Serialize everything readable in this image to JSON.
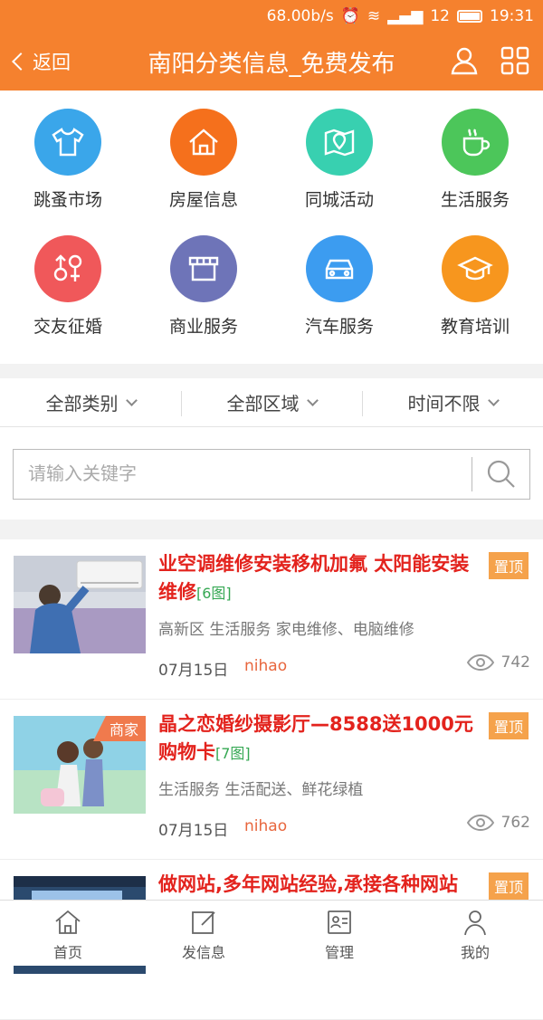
{
  "status": {
    "speed": "68.00b/s",
    "signal_num": "12",
    "time": "19:31"
  },
  "header": {
    "back_label": "返回",
    "title": "南阳分类信息_免费发布"
  },
  "categories": [
    {
      "label": "跳蚤市场",
      "color": "#3aa6ea",
      "icon": "tshirt-icon"
    },
    {
      "label": "房屋信息",
      "color": "#f5701c",
      "icon": "house-icon"
    },
    {
      "label": "同城活动",
      "color": "#38d0b0",
      "icon": "map-pin-icon"
    },
    {
      "label": "生活服务",
      "color": "#4cc65a",
      "icon": "cup-icon"
    },
    {
      "label": "交友征婚",
      "color": "#f0585a",
      "icon": "gender-icon"
    },
    {
      "label": "商业服务",
      "color": "#6e74b8",
      "icon": "shop-icon"
    },
    {
      "label": "汽车服务",
      "color": "#3c9cf0",
      "icon": "car-icon"
    },
    {
      "label": "教育培训",
      "color": "#f7961e",
      "icon": "graduation-cap-icon"
    }
  ],
  "filters": [
    "全部类别",
    "全部区域",
    "时间不限"
  ],
  "search": {
    "placeholder": "请输入关键字"
  },
  "listings": [
    {
      "title": "业空调维修安装移机加氟 太阳能安装维修",
      "pics": "[6图]",
      "pin": "置顶",
      "category": "高新区 生活服务 家电维修、电脑维修",
      "date": "07月15日",
      "user": "nihao",
      "views": "742",
      "shop_tag": ""
    },
    {
      "title": "晶之恋婚纱摄影厅—8588送1000元购物卡",
      "pics": "[7图]",
      "pin": "置顶",
      "category": "生活服务 生活配送、鲜花绿植",
      "date": "07月15日",
      "user": "nihao",
      "views": "762",
      "shop_tag": "商家"
    },
    {
      "title": "做网站,多年网站经验,承接各种网站",
      "pics": "",
      "pin": "置顶",
      "category": "",
      "date": "",
      "user": "",
      "views": "",
      "shop_tag": ""
    }
  ],
  "tabs": [
    {
      "label": "首页",
      "icon": "home-icon"
    },
    {
      "label": "发信息",
      "icon": "edit-icon"
    },
    {
      "label": "管理",
      "icon": "id-card-icon"
    },
    {
      "label": "我的",
      "icon": "user-icon"
    }
  ]
}
